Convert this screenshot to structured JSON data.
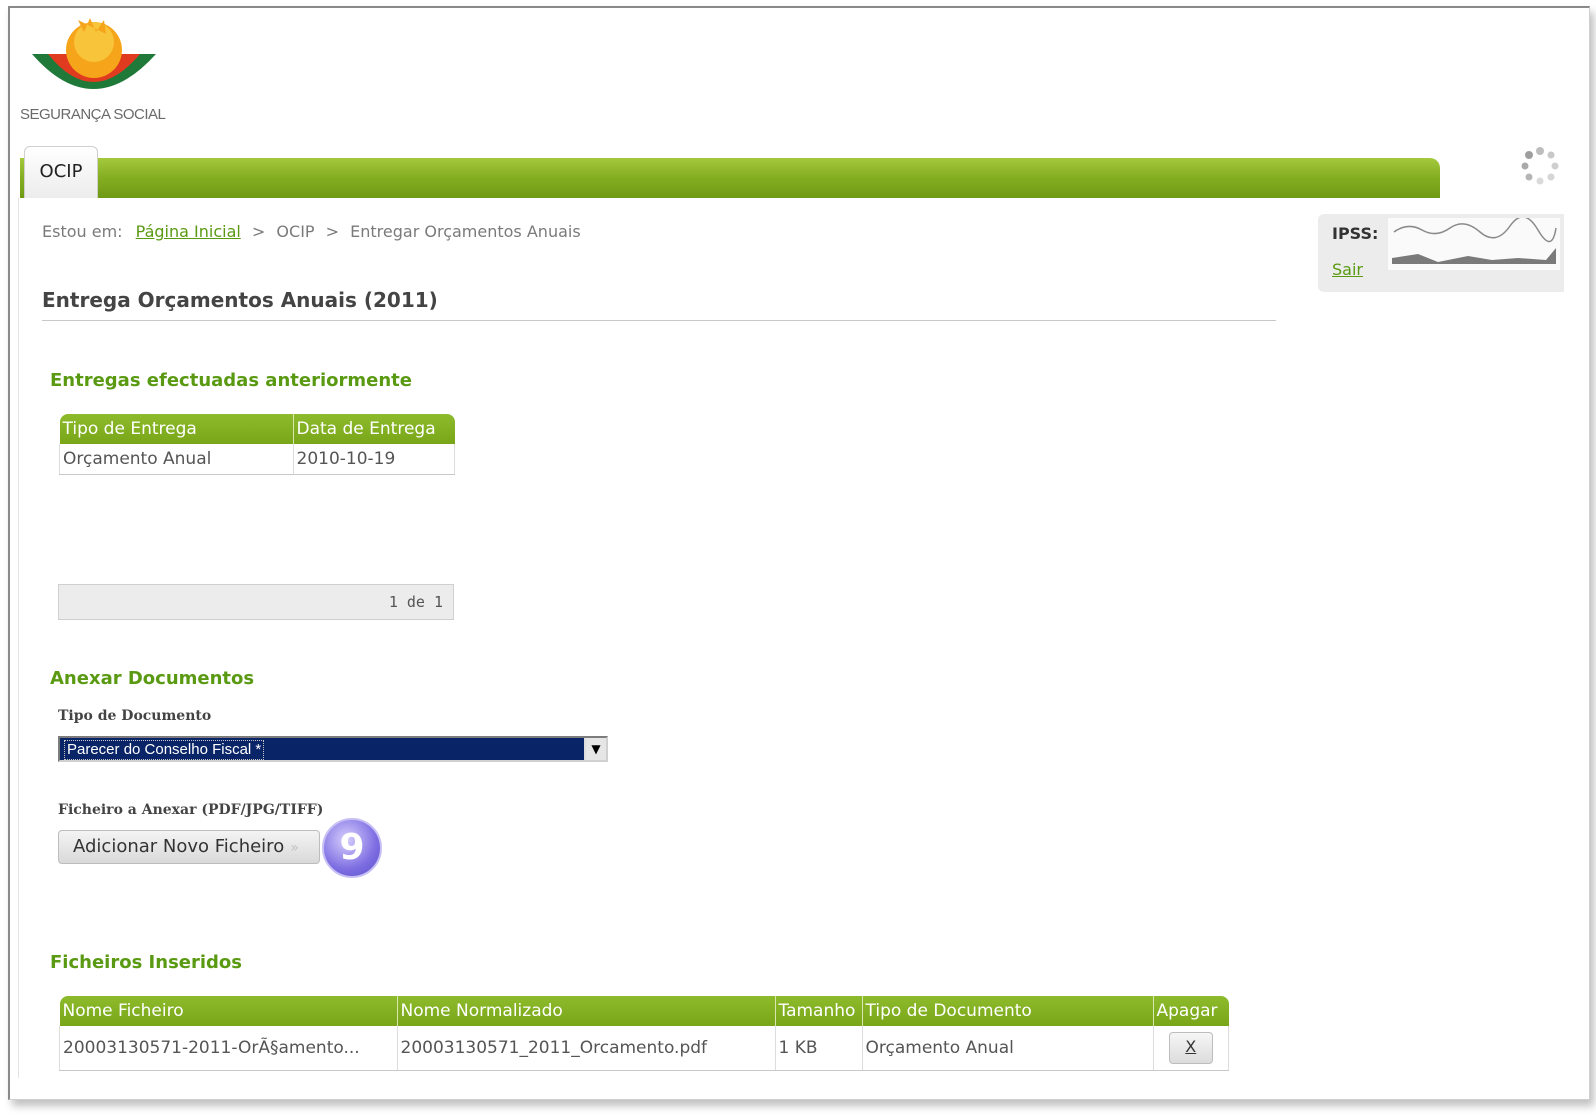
{
  "brand": {
    "logo_text": "SEGURANÇA SOCIAL"
  },
  "nav": {
    "tab_label": "OCIP"
  },
  "breadcrumb": {
    "prefix": "Estou em:",
    "home": "Página Inicial",
    "separator": ">",
    "item1": "OCIP",
    "item2": "Entregar Orçamentos Anuais"
  },
  "user": {
    "label": "IPSS:",
    "logout": "Sair"
  },
  "page": {
    "title": "Entrega Orçamentos Anuais (2011)"
  },
  "previous_deliveries": {
    "heading": "Entregas efectuadas anteriormente",
    "columns": [
      "Tipo de Entrega",
      "Data de Entrega"
    ],
    "rows": [
      [
        "Orçamento Anual",
        "2010-10-19"
      ]
    ],
    "pager": "1 de 1"
  },
  "attach": {
    "heading": "Anexar Documentos",
    "doc_type_label": "Tipo de Documento",
    "doc_type_value": "Parecer do Conselho Fiscal *",
    "file_label": "Ficheiro a Anexar (PDF/JPG/TIFF)",
    "add_button": "Adicionar Novo Ficheiro",
    "add_button_chevron": "»",
    "step_badge": "9"
  },
  "inserted_files": {
    "heading": "Ficheiros Inseridos",
    "columns": [
      "Nome Ficheiro",
      "Nome Normalizado",
      "Tamanho",
      "Tipo de Documento",
      "Apagar"
    ],
    "rows": [
      {
        "name": "20003130571-2011-OrÃ§amento...",
        "normalized": "20003130571_2011_Orcamento.pdf",
        "size": "1 KB",
        "doc_type": "Orçamento Anual",
        "delete": "X"
      }
    ]
  },
  "colors": {
    "accent_green": "#5a9a12",
    "bar_green": "#84ad21",
    "select_bg": "#0a2468",
    "badge_purple": "#7d6ee2"
  },
  "icons": {
    "logo": "seguranca-social-sun-logo",
    "spinner": "loading-spinner-icon",
    "dropdown": "chevron-down-icon"
  }
}
